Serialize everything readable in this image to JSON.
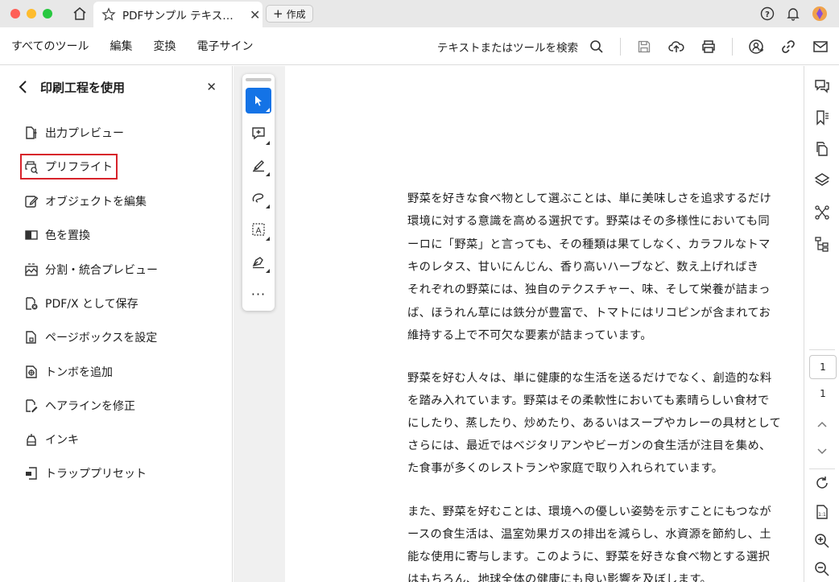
{
  "titlebar": {
    "tab_title": "PDFサンプル テキス…",
    "new_tab_label": "作成"
  },
  "menubar": {
    "items": [
      "すべてのツール",
      "編集",
      "変換",
      "電子サイン"
    ],
    "search_text": "テキストまたはツールを検索"
  },
  "left_panel": {
    "title": "印刷工程を使用",
    "tools": [
      {
        "label": "出力プレビュー",
        "icon": "output-preview-icon"
      },
      {
        "label": "プリフライト",
        "icon": "preflight-icon",
        "selected": true
      },
      {
        "label": "オブジェクトを編集",
        "icon": "edit-object-icon"
      },
      {
        "label": "色を置換",
        "icon": "replace-color-icon"
      },
      {
        "label": "分割・統合プレビュー",
        "icon": "flattener-preview-icon"
      },
      {
        "label": "PDF/X として保存",
        "icon": "save-pdfx-icon"
      },
      {
        "label": "ページボックスを設定",
        "icon": "set-page-boxes-icon"
      },
      {
        "label": "トンボを追加",
        "icon": "add-printer-marks-icon"
      },
      {
        "label": "ヘアラインを修正",
        "icon": "fix-hairlines-icon"
      },
      {
        "label": "インキ",
        "icon": "ink-manager-icon"
      },
      {
        "label": "トラッププリセット",
        "icon": "trap-presets-icon"
      }
    ]
  },
  "document": {
    "paragraphs": [
      [
        "野菜を好きな食べ物として選ぶことは、単に美味しさを追求するだけ",
        "環境に対する意識を高める選択です。野菜はその多様性においても同",
        "ーロに「野菜」と言っても、その種類は果てしなく、カラフルなトマ",
        "キのレタス、甘いにんじん、香り高いハーブなど、数え上げればき",
        "それぞれの野菜には、独自のテクスチャー、味、そして栄養が詰まっ",
        "ば、ほうれん草には鉄分が豊富で、トマトにはリコピンが含まれてお",
        "維持する上で不可欠な要素が詰まっています。"
      ],
      [
        "野菜を好む人々は、単に健康的な生活を送るだけでなく、創造的な料",
        "を踏み入れています。野菜はその柔軟性においても素晴らしい食材で",
        "にしたり、蒸したり、炒めたり、あるいはスープやカレーの具材として",
        "さらには、最近ではベジタリアンやビーガンの食生活が注目を集め、",
        "た食事が多くのレストランや家庭で取り入れられています。"
      ],
      [
        "また、野菜を好むことは、環境への優しい姿勢を示すことにもつなが",
        "ースの食生活は、温室効果ガスの排出を減らし、水資源を節約し、土",
        "能な使用に寄与します。このように、野菜を好きな食べ物とする選択",
        "はもちろん、地球全体の健康にも良い影響を及ぼします。"
      ]
    ]
  },
  "page_nav": {
    "current": "1",
    "total": "1"
  },
  "colors": {
    "accent": "#1473e6",
    "selection_outline": "#d7222a"
  }
}
